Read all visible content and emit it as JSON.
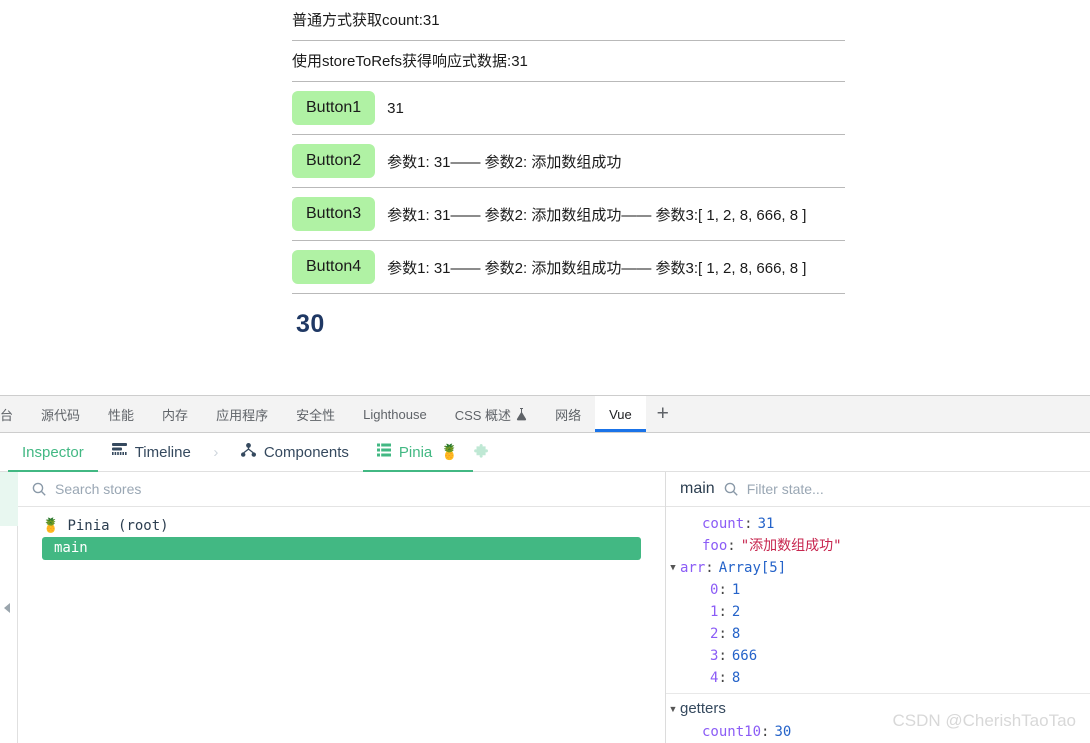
{
  "page": {
    "lines": [
      {
        "text": "普通方式获取count:31"
      },
      {
        "text": "使用storeToRefs获得响应式数据:31"
      }
    ],
    "buttons": [
      {
        "label": "Button1",
        "output": "31"
      },
      {
        "label": "Button2",
        "output": "参数1: 31—— 参数2: 添加数组成功"
      },
      {
        "label": "Button3",
        "output": "参数1: 31—— 参数2: 添加数组成功—— 参数3:[ 1, 2, 8, 666, 8 ]"
      },
      {
        "label": "Button4",
        "output": "参数1: 31—— 参数2: 添加数组成功—— 参数3:[ 1, 2, 8, 666, 8 ]"
      }
    ],
    "getter_value": "30",
    "button_color": "#b0f2a4",
    "heading_color": "#1f3864"
  },
  "devtools": {
    "tabs": [
      {
        "label": "台",
        "active": false,
        "icon": ""
      },
      {
        "label": "源代码",
        "active": false,
        "icon": ""
      },
      {
        "label": "性能",
        "active": false,
        "icon": ""
      },
      {
        "label": "内存",
        "active": false,
        "icon": ""
      },
      {
        "label": "应用程序",
        "active": false,
        "icon": ""
      },
      {
        "label": "安全性",
        "active": false,
        "icon": ""
      },
      {
        "label": "Lighthouse",
        "active": false,
        "icon": ""
      },
      {
        "label": "CSS 概述",
        "active": false,
        "icon": "flask-icon"
      },
      {
        "label": "网络",
        "active": false,
        "icon": ""
      },
      {
        "label": "Vue",
        "active": true,
        "icon": ""
      }
    ],
    "add_tab_label": "+",
    "active_tab_accent": "#1a73e8"
  },
  "vue_nav": {
    "items": [
      {
        "label": "Inspector",
        "icon": "",
        "active": true,
        "emoji": ""
      },
      {
        "label": "Timeline",
        "icon": "timeline-icon",
        "active": false,
        "emoji": ""
      },
      {
        "label": "Components",
        "icon": "components-tree-icon",
        "active": false,
        "emoji": ""
      },
      {
        "label": "Pinia",
        "icon": "pinia-list-icon",
        "active": true,
        "emoji": "🍍"
      }
    ],
    "chevron": "›",
    "puzzle_icon": "🧩",
    "accent": "#42b883"
  },
  "stores_pane": {
    "search_placeholder": "Search stores",
    "search_value": "",
    "search_icon": "search-icon",
    "root_label": "Pinia (root)",
    "root_emoji": "🍍",
    "stores": [
      {
        "name": "main",
        "selected": true
      }
    ]
  },
  "state_pane": {
    "title": "main",
    "filter_placeholder": "Filter state...",
    "filter_value": "",
    "search_icon": "search-icon",
    "rows": [
      {
        "kind": "prop",
        "indent": 1,
        "caret": "",
        "key": "count",
        "value": "31",
        "type": "number"
      },
      {
        "kind": "prop",
        "indent": 1,
        "caret": "",
        "key": "foo",
        "value": "\"添加数组成功\"",
        "type": "string"
      },
      {
        "kind": "prop",
        "indent": 0,
        "caret": "▼",
        "key": "arr",
        "value": "Array[5]",
        "type": "type"
      },
      {
        "kind": "prop",
        "indent": 2,
        "caret": "",
        "key": "0",
        "value": "1",
        "type": "number"
      },
      {
        "kind": "prop",
        "indent": 2,
        "caret": "",
        "key": "1",
        "value": "2",
        "type": "number"
      },
      {
        "kind": "prop",
        "indent": 2,
        "caret": "",
        "key": "2",
        "value": "8",
        "type": "number"
      },
      {
        "kind": "prop",
        "indent": 2,
        "caret": "",
        "key": "3",
        "value": "666",
        "type": "number"
      },
      {
        "kind": "prop",
        "indent": 2,
        "caret": "",
        "key": "4",
        "value": "8",
        "type": "number"
      },
      {
        "kind": "section",
        "indent": 0,
        "caret": "▼",
        "key": "getters",
        "value": "",
        "type": ""
      },
      {
        "kind": "prop",
        "indent": 1,
        "caret": "",
        "key": "count10",
        "value": "30",
        "type": "number"
      }
    ]
  },
  "watermark": "CSDN @CherishTaoTao"
}
